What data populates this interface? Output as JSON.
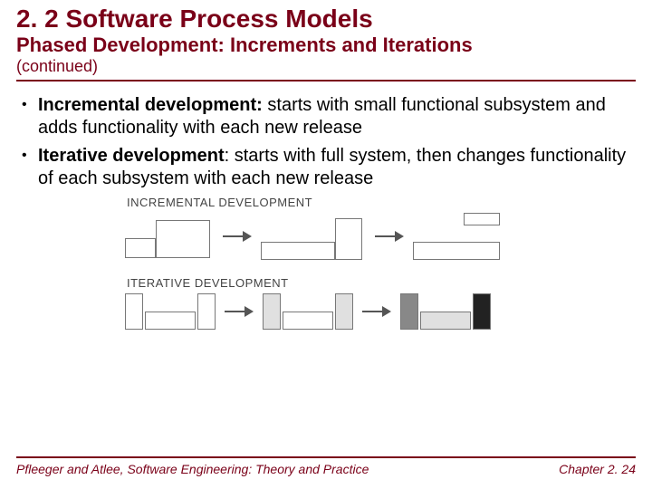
{
  "title": "2. 2 Software Process Models",
  "subtitle": "Phased Development: Increments and Iterations",
  "continued": "(continued)",
  "bullets": [
    {
      "term": "Incremental development:",
      "rest": " starts with small functional subsystem and adds functionality with each new release"
    },
    {
      "term": "Iterative development",
      "rest": ": starts with full system, then changes functionality of each subsystem with each new release"
    }
  ],
  "figure": {
    "label_incremental": "INCREMENTAL DEVELOPMENT",
    "label_iterative": "ITERATIVE DEVELOPMENT"
  },
  "footer": {
    "left": "Pfleeger and Atlee, Software Engineering: Theory and Practice",
    "right": "Chapter 2. 24"
  }
}
